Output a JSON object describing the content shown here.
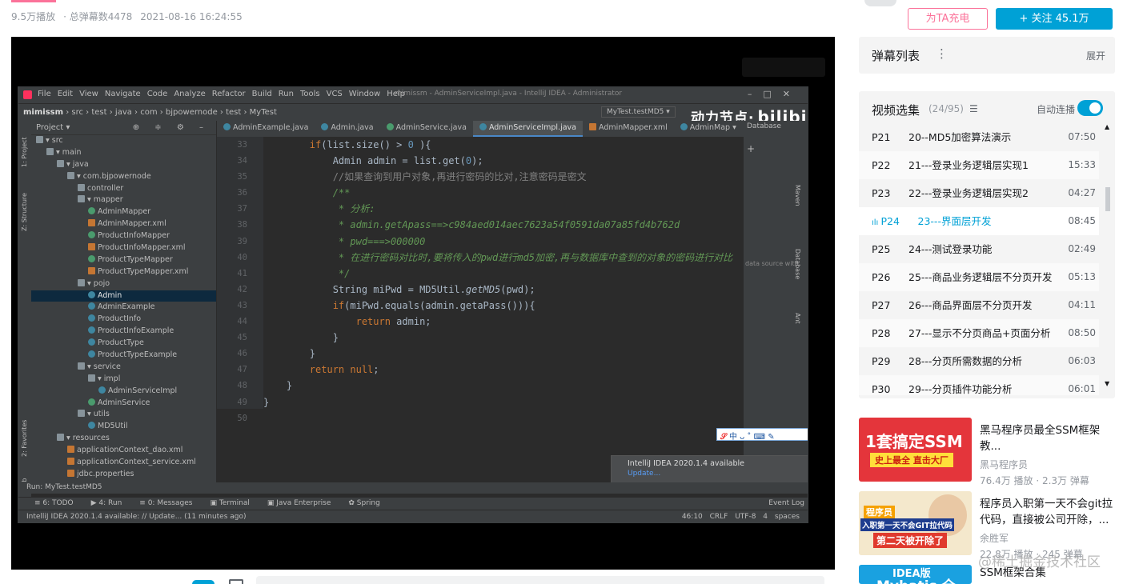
{
  "video_meta": {
    "plays": "9.5万播放",
    "danmaku_total": "· 总弹幕数4478",
    "datetime": "2021-08-16 16:24:55"
  },
  "uploader": {
    "charge_label": "为TA充电",
    "follow_label": "+ 关注 45.1万"
  },
  "ide": {
    "menu": [
      "File",
      "Edit",
      "View",
      "Navigate",
      "Code",
      "Analyze",
      "Refactor",
      "Build",
      "Run",
      "Tools",
      "VCS",
      "Window",
      "Help"
    ],
    "window_title": "mimissm - AdminServiceImpl.java - IntelliJ IDEA - Administrator",
    "breadcrumb": {
      "project": "mimissm",
      "rest": "› src › test › java › com › bjpowernode › test › MyTest"
    },
    "run_config": "MyTest.testMD5 ▾",
    "logo_text": "动力节点·",
    "logo_bili": "bilibili",
    "project_header": "Project ▾",
    "left_strip": [
      "1: Project",
      "Z: Structure",
      "2: Favorites",
      "Web"
    ],
    "tree": [
      {
        "label": "▾ src",
        "indent": 0,
        "icon": "folder"
      },
      {
        "label": "▾ main",
        "indent": 1,
        "icon": "folder"
      },
      {
        "label": "▾ java",
        "indent": 2,
        "icon": "folder"
      },
      {
        "label": "▾ com.bjpowernode",
        "indent": 3,
        "icon": "folder"
      },
      {
        "label": "controller",
        "indent": 4,
        "icon": "folder"
      },
      {
        "label": "▾ mapper",
        "indent": 4,
        "icon": "folder"
      },
      {
        "label": "AdminMapper",
        "indent": 5,
        "icon": "interface"
      },
      {
        "label": "AdminMapper.xml",
        "indent": 5,
        "icon": "xml"
      },
      {
        "label": "ProductInfoMapper",
        "indent": 5,
        "icon": "interface"
      },
      {
        "label": "ProductInfoMapper.xml",
        "indent": 5,
        "icon": "xml"
      },
      {
        "label": "ProductTypeMapper",
        "indent": 5,
        "icon": "interface"
      },
      {
        "label": "ProductTypeMapper.xml",
        "indent": 5,
        "icon": "xml"
      },
      {
        "label": "▾ pojo",
        "indent": 4,
        "icon": "folder"
      },
      {
        "label": "Admin",
        "indent": 5,
        "icon": "class",
        "selected": true
      },
      {
        "label": "AdminExample",
        "indent": 5,
        "icon": "class"
      },
      {
        "label": "ProductInfo",
        "indent": 5,
        "icon": "class"
      },
      {
        "label": "ProductInfoExample",
        "indent": 5,
        "icon": "class"
      },
      {
        "label": "ProductType",
        "indent": 5,
        "icon": "class"
      },
      {
        "label": "ProductTypeExample",
        "indent": 5,
        "icon": "class"
      },
      {
        "label": "▾ service",
        "indent": 4,
        "icon": "folder"
      },
      {
        "label": "▾ impl",
        "indent": 5,
        "icon": "folder"
      },
      {
        "label": "AdminServiceImpl",
        "indent": 6,
        "icon": "class"
      },
      {
        "label": "AdminService",
        "indent": 5,
        "icon": "interface"
      },
      {
        "label": "▾ utils",
        "indent": 4,
        "icon": "folder"
      },
      {
        "label": "MD5Util",
        "indent": 5,
        "icon": "class"
      },
      {
        "label": "▾ resources",
        "indent": 2,
        "icon": "folder"
      },
      {
        "label": "applicationContext_dao.xml",
        "indent": 3,
        "icon": "xml"
      },
      {
        "label": "applicationContext_service.xml",
        "indent": 3,
        "icon": "xml"
      },
      {
        "label": "jdbc.properties",
        "indent": 3,
        "icon": "xml"
      }
    ],
    "tabs": [
      "AdminExample.java",
      "Admin.java",
      "AdminService.java",
      "AdminServiceImpl.java",
      "AdminMapper.xml",
      "AdminMap ▾"
    ],
    "active_tab": 3,
    "line_numbers": [
      "33",
      "34",
      "35",
      "36",
      "37",
      "38",
      "39",
      "40",
      "41",
      "42",
      "43",
      "44",
      "45",
      "46",
      "47",
      "48",
      "49",
      "50"
    ],
    "code_lines": [
      [
        {
          "t": "        "
        },
        {
          "t": "if",
          "c": "kw"
        },
        {
          "t": "(list.size() > "
        },
        {
          "t": "0",
          "c": "nm"
        },
        {
          "t": " ){"
        }
      ],
      [
        {
          "t": "            Admin admin = list.get("
        },
        {
          "t": "0",
          "c": "nm"
        },
        {
          "t": ");"
        }
      ],
      [
        {
          "t": "            "
        },
        {
          "t": "//如果查询到用户对象,再进行密码的比对,注意密码是密文",
          "c": "cm"
        }
      ],
      [
        {
          "t": "            "
        },
        {
          "t": "/**",
          "c": "dc"
        }
      ],
      [
        {
          "t": "             "
        },
        {
          "t": "* 分析:",
          "c": "dc"
        }
      ],
      [
        {
          "t": "             "
        },
        {
          "t": "* admin.getApass==>c984aed014aec7623a54f0591da07a85fd4b762d",
          "c": "dc"
        }
      ],
      [
        {
          "t": "             "
        },
        {
          "t": "* pwd===>000000",
          "c": "dc"
        }
      ],
      [
        {
          "t": "             "
        },
        {
          "t": "* 在进行密码对比时,要将传入的pwd进行md5加密,再与数据库中查到的对象的密码进行对比",
          "c": "dc"
        }
      ],
      [
        {
          "t": "             "
        },
        {
          "t": "*/",
          "c": "dc"
        }
      ],
      [
        {
          "t": "            String miPwd = MD5Util."
        },
        {
          "t": "getMD5",
          "c": "it"
        },
        {
          "t": "(pwd);"
        }
      ],
      [
        {
          "t": "            "
        },
        {
          "t": "if",
          "c": "kw"
        },
        {
          "t": "(miPwd.equals(admin.getaPass())){"
        }
      ],
      [
        {
          "t": "                "
        },
        {
          "t": "return",
          "c": "kw"
        },
        {
          "t": " admin;"
        }
      ],
      [
        {
          "t": "            }"
        }
      ],
      [
        {
          "t": "        }"
        }
      ],
      [
        {
          "t": "        "
        },
        {
          "t": "return null",
          "c": "kw"
        },
        {
          "t": ";"
        }
      ],
      [
        {
          "t": "    }"
        }
      ],
      [
        {
          "t": "}"
        }
      ],
      [
        {
          "t": ""
        }
      ]
    ],
    "db_panel": {
      "title": "Database",
      "hint": "data source with Al"
    },
    "right_strip": [
      "Maven",
      "Database",
      "Ant"
    ],
    "ime_text": "中 ᴗ ˚ ⌨ ✎",
    "notification": {
      "title": "IntelliJ IDEA 2020.1.4 available",
      "link": "Update..."
    },
    "run_bar": "Run:   MyTest.testMD5",
    "tool_windows": [
      "≡ 6: TODO",
      "▶ 4: Run",
      "≡ 0: Messages",
      "▣ Terminal",
      "▣ Java Enterprise",
      "✿ Spring"
    ],
    "event_log": "Event Log",
    "status_left": "IntelliJ IDEA 2020.1.4 available: // Update... (11 minutes ago)",
    "status_right": "46:10  CRLF  UTF-8  4 spaces"
  },
  "danmaku_list": {
    "title": "弹幕列表",
    "more": "⋮",
    "expand": "展开"
  },
  "episodes": {
    "title": "视频选集",
    "count": "(24/95)",
    "list_icon": "list-icon",
    "autoplay_label": "自动连播",
    "autoplay_on": true,
    "items": [
      {
        "num": "P21",
        "title": "20--MD5加密算法演示",
        "duration": "07:50"
      },
      {
        "num": "P22",
        "title": "21---登录业务逻辑层实现1",
        "duration": "15:33"
      },
      {
        "num": "P23",
        "title": "22---登录业务逻辑层实现2",
        "duration": "04:27"
      },
      {
        "num": "P24",
        "title": "23---界面层开发",
        "duration": "08:45",
        "current": true
      },
      {
        "num": "P25",
        "title": "24---测试登录功能",
        "duration": "02:49"
      },
      {
        "num": "P26",
        "title": "25---商品业务逻辑层不分页开发",
        "duration": "05:13"
      },
      {
        "num": "P27",
        "title": "26---商品界面层不分页开发",
        "duration": "04:11"
      },
      {
        "num": "P28",
        "title": "27---显示不分页商品+页面分析",
        "duration": "08:50"
      },
      {
        "num": "P29",
        "title": "28---分页所需数据的分析",
        "duration": "06:03"
      },
      {
        "num": "P30",
        "title": "29---分页插件功能分析",
        "duration": "06:01"
      }
    ]
  },
  "recommendations": [
    {
      "title": "黑马程序员最全SSM框架教...",
      "author": "黑马程序员",
      "stats": "76.4万 播放 · 2.3万 弹幕",
      "thumb_big": "1套搞定SSM",
      "thumb_small": "史上最全 直击大厂"
    },
    {
      "title": "程序员入职第一天不会git拉代码，直接被公司开除，...",
      "author": "余胜军",
      "stats": "22.8万 播放 · 245 弹幕",
      "thumb_l1": "程序员",
      "thumb_l2": "入职第一天不会GIT拉代码",
      "thumb_l3": "第二天被开除了"
    },
    {
      "title": "SSM框架合集",
      "author": "",
      "stats": "",
      "thumb_l1": "IDEA版",
      "thumb_l2": "Mybatis 全"
    }
  ],
  "watermark": "@稀土掘金技术社区"
}
